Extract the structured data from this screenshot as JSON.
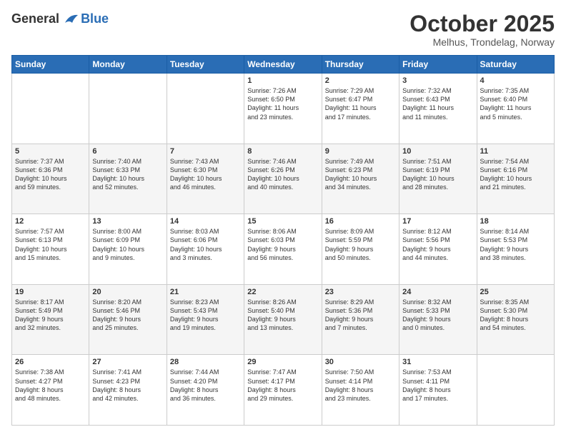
{
  "header": {
    "logo_line1": "General",
    "logo_line2": "Blue",
    "month_year": "October 2025",
    "location": "Melhus, Trondelag, Norway"
  },
  "weekdays": [
    "Sunday",
    "Monday",
    "Tuesday",
    "Wednesday",
    "Thursday",
    "Friday",
    "Saturday"
  ],
  "weeks": [
    [
      {
        "day": "",
        "text": ""
      },
      {
        "day": "",
        "text": ""
      },
      {
        "day": "",
        "text": ""
      },
      {
        "day": "1",
        "text": "Sunrise: 7:26 AM\nSunset: 6:50 PM\nDaylight: 11 hours\nand 23 minutes."
      },
      {
        "day": "2",
        "text": "Sunrise: 7:29 AM\nSunset: 6:47 PM\nDaylight: 11 hours\nand 17 minutes."
      },
      {
        "day": "3",
        "text": "Sunrise: 7:32 AM\nSunset: 6:43 PM\nDaylight: 11 hours\nand 11 minutes."
      },
      {
        "day": "4",
        "text": "Sunrise: 7:35 AM\nSunset: 6:40 PM\nDaylight: 11 hours\nand 5 minutes."
      }
    ],
    [
      {
        "day": "5",
        "text": "Sunrise: 7:37 AM\nSunset: 6:36 PM\nDaylight: 10 hours\nand 59 minutes."
      },
      {
        "day": "6",
        "text": "Sunrise: 7:40 AM\nSunset: 6:33 PM\nDaylight: 10 hours\nand 52 minutes."
      },
      {
        "day": "7",
        "text": "Sunrise: 7:43 AM\nSunset: 6:30 PM\nDaylight: 10 hours\nand 46 minutes."
      },
      {
        "day": "8",
        "text": "Sunrise: 7:46 AM\nSunset: 6:26 PM\nDaylight: 10 hours\nand 40 minutes."
      },
      {
        "day": "9",
        "text": "Sunrise: 7:49 AM\nSunset: 6:23 PM\nDaylight: 10 hours\nand 34 minutes."
      },
      {
        "day": "10",
        "text": "Sunrise: 7:51 AM\nSunset: 6:19 PM\nDaylight: 10 hours\nand 28 minutes."
      },
      {
        "day": "11",
        "text": "Sunrise: 7:54 AM\nSunset: 6:16 PM\nDaylight: 10 hours\nand 21 minutes."
      }
    ],
    [
      {
        "day": "12",
        "text": "Sunrise: 7:57 AM\nSunset: 6:13 PM\nDaylight: 10 hours\nand 15 minutes."
      },
      {
        "day": "13",
        "text": "Sunrise: 8:00 AM\nSunset: 6:09 PM\nDaylight: 10 hours\nand 9 minutes."
      },
      {
        "day": "14",
        "text": "Sunrise: 8:03 AM\nSunset: 6:06 PM\nDaylight: 10 hours\nand 3 minutes."
      },
      {
        "day": "15",
        "text": "Sunrise: 8:06 AM\nSunset: 6:03 PM\nDaylight: 9 hours\nand 56 minutes."
      },
      {
        "day": "16",
        "text": "Sunrise: 8:09 AM\nSunset: 5:59 PM\nDaylight: 9 hours\nand 50 minutes."
      },
      {
        "day": "17",
        "text": "Sunrise: 8:12 AM\nSunset: 5:56 PM\nDaylight: 9 hours\nand 44 minutes."
      },
      {
        "day": "18",
        "text": "Sunrise: 8:14 AM\nSunset: 5:53 PM\nDaylight: 9 hours\nand 38 minutes."
      }
    ],
    [
      {
        "day": "19",
        "text": "Sunrise: 8:17 AM\nSunset: 5:49 PM\nDaylight: 9 hours\nand 32 minutes."
      },
      {
        "day": "20",
        "text": "Sunrise: 8:20 AM\nSunset: 5:46 PM\nDaylight: 9 hours\nand 25 minutes."
      },
      {
        "day": "21",
        "text": "Sunrise: 8:23 AM\nSunset: 5:43 PM\nDaylight: 9 hours\nand 19 minutes."
      },
      {
        "day": "22",
        "text": "Sunrise: 8:26 AM\nSunset: 5:40 PM\nDaylight: 9 hours\nand 13 minutes."
      },
      {
        "day": "23",
        "text": "Sunrise: 8:29 AM\nSunset: 5:36 PM\nDaylight: 9 hours\nand 7 minutes."
      },
      {
        "day": "24",
        "text": "Sunrise: 8:32 AM\nSunset: 5:33 PM\nDaylight: 9 hours\nand 0 minutes."
      },
      {
        "day": "25",
        "text": "Sunrise: 8:35 AM\nSunset: 5:30 PM\nDaylight: 8 hours\nand 54 minutes."
      }
    ],
    [
      {
        "day": "26",
        "text": "Sunrise: 7:38 AM\nSunset: 4:27 PM\nDaylight: 8 hours\nand 48 minutes."
      },
      {
        "day": "27",
        "text": "Sunrise: 7:41 AM\nSunset: 4:23 PM\nDaylight: 8 hours\nand 42 minutes."
      },
      {
        "day": "28",
        "text": "Sunrise: 7:44 AM\nSunset: 4:20 PM\nDaylight: 8 hours\nand 36 minutes."
      },
      {
        "day": "29",
        "text": "Sunrise: 7:47 AM\nSunset: 4:17 PM\nDaylight: 8 hours\nand 29 minutes."
      },
      {
        "day": "30",
        "text": "Sunrise: 7:50 AM\nSunset: 4:14 PM\nDaylight: 8 hours\nand 23 minutes."
      },
      {
        "day": "31",
        "text": "Sunrise: 7:53 AM\nSunset: 4:11 PM\nDaylight: 8 hours\nand 17 minutes."
      },
      {
        "day": "",
        "text": ""
      }
    ]
  ]
}
